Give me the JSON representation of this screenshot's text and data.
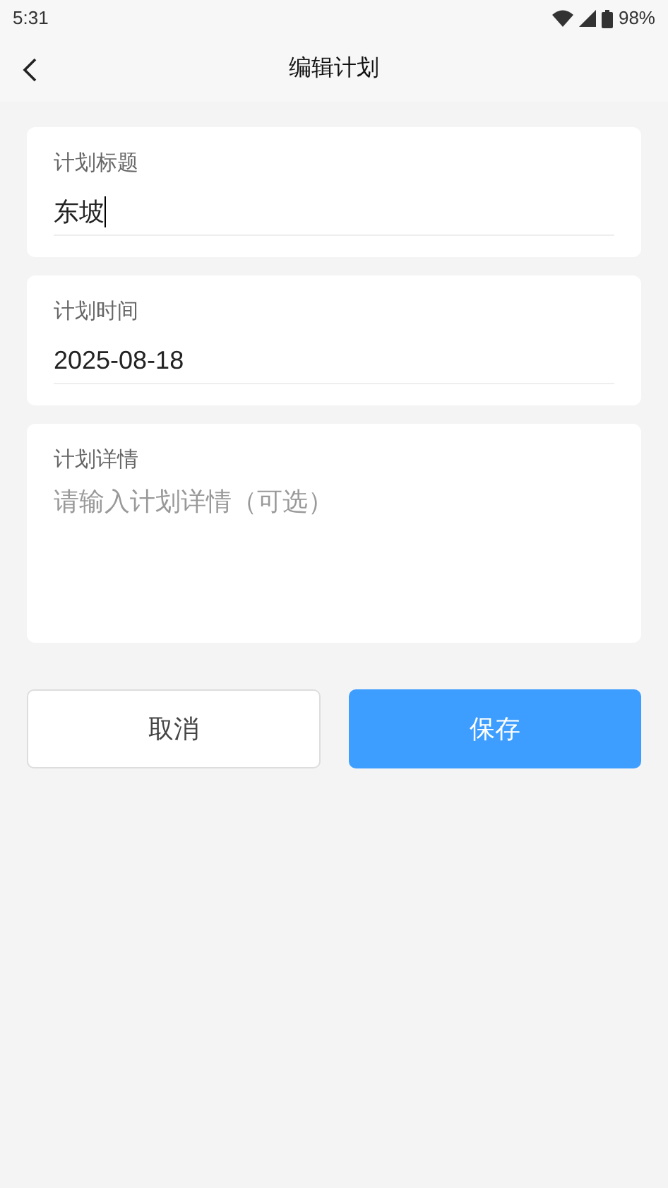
{
  "status_bar": {
    "time": "5:31",
    "battery": "98%"
  },
  "header": {
    "title": "编辑计划"
  },
  "fields": [
    {
      "label": "计划标题",
      "value": "东坡",
      "focused": true
    },
    {
      "label": "计划时间",
      "value": "2025-08-18",
      "focused": false
    },
    {
      "label": "计划详情",
      "placeholder": "请输入计划详情（可选）",
      "kind": "multiline",
      "focused": false
    }
  ],
  "buttons": [
    {
      "label": "取消",
      "kind": "secondary"
    },
    {
      "label": "保存",
      "kind": "primary"
    }
  ]
}
